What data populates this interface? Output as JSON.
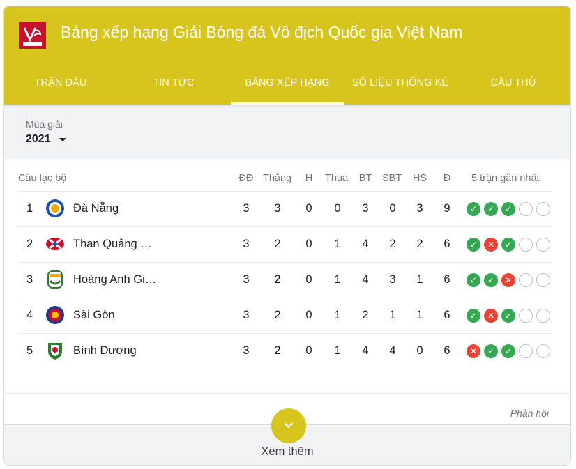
{
  "header": {
    "title": "Bảng xếp hạng Giải Bóng đá Vô địch Quốc gia Việt Nam",
    "logo_text": "V.LEAGUE 1",
    "color": "#d7c51e"
  },
  "tabs": [
    {
      "label": "Trận đấu",
      "active": false
    },
    {
      "label": "Tin tức",
      "active": false
    },
    {
      "label": "Bảng xếp hạng",
      "active": true
    },
    {
      "label": "Số liệu thống kê",
      "active": false
    },
    {
      "label": "Cầu thủ",
      "active": false
    }
  ],
  "season": {
    "label": "Mùa giải",
    "value": "2021"
  },
  "table": {
    "columns": [
      "Câu lạc bộ",
      "ĐĐ",
      "Thắng",
      "H",
      "Thua",
      "BT",
      "SBT",
      "HS",
      "Đ",
      "5 trận gần nhất"
    ],
    "rows": [
      {
        "rank": "1",
        "team": "Đà Nẵng",
        "crest": "da-nang-crest",
        "played": "3",
        "won": "3",
        "drawn": "0",
        "lost": "0",
        "gf": "3",
        "ga": "0",
        "gd": "3",
        "pts": "9",
        "form": [
          "win",
          "win",
          "win",
          "empty",
          "empty"
        ]
      },
      {
        "rank": "2",
        "team": "Than Quảng …",
        "crest": "than-quang-ninh-crest",
        "played": "3",
        "won": "2",
        "drawn": "0",
        "lost": "1",
        "gf": "4",
        "ga": "2",
        "gd": "2",
        "pts": "6",
        "form": [
          "win",
          "loss",
          "win",
          "empty",
          "empty"
        ]
      },
      {
        "rank": "3",
        "team": "Hoàng Anh Gi…",
        "crest": "hagl-crest",
        "played": "3",
        "won": "2",
        "drawn": "0",
        "lost": "1",
        "gf": "4",
        "ga": "3",
        "gd": "1",
        "pts": "6",
        "form": [
          "win",
          "win",
          "loss",
          "empty",
          "empty"
        ]
      },
      {
        "rank": "4",
        "team": "Sài Gòn",
        "crest": "sai-gon-crest",
        "played": "3",
        "won": "2",
        "drawn": "0",
        "lost": "1",
        "gf": "2",
        "ga": "1",
        "gd": "1",
        "pts": "6",
        "form": [
          "win",
          "loss",
          "win",
          "empty",
          "empty"
        ]
      },
      {
        "rank": "5",
        "team": "Bình Dương",
        "crest": "binh-duong-crest",
        "played": "3",
        "won": "2",
        "drawn": "0",
        "lost": "1",
        "gf": "4",
        "ga": "4",
        "gd": "0",
        "pts": "6",
        "form": [
          "loss",
          "win",
          "win",
          "empty",
          "empty"
        ]
      }
    ]
  },
  "feedback": "Phản hồi",
  "more": {
    "label": "Xem thêm"
  }
}
